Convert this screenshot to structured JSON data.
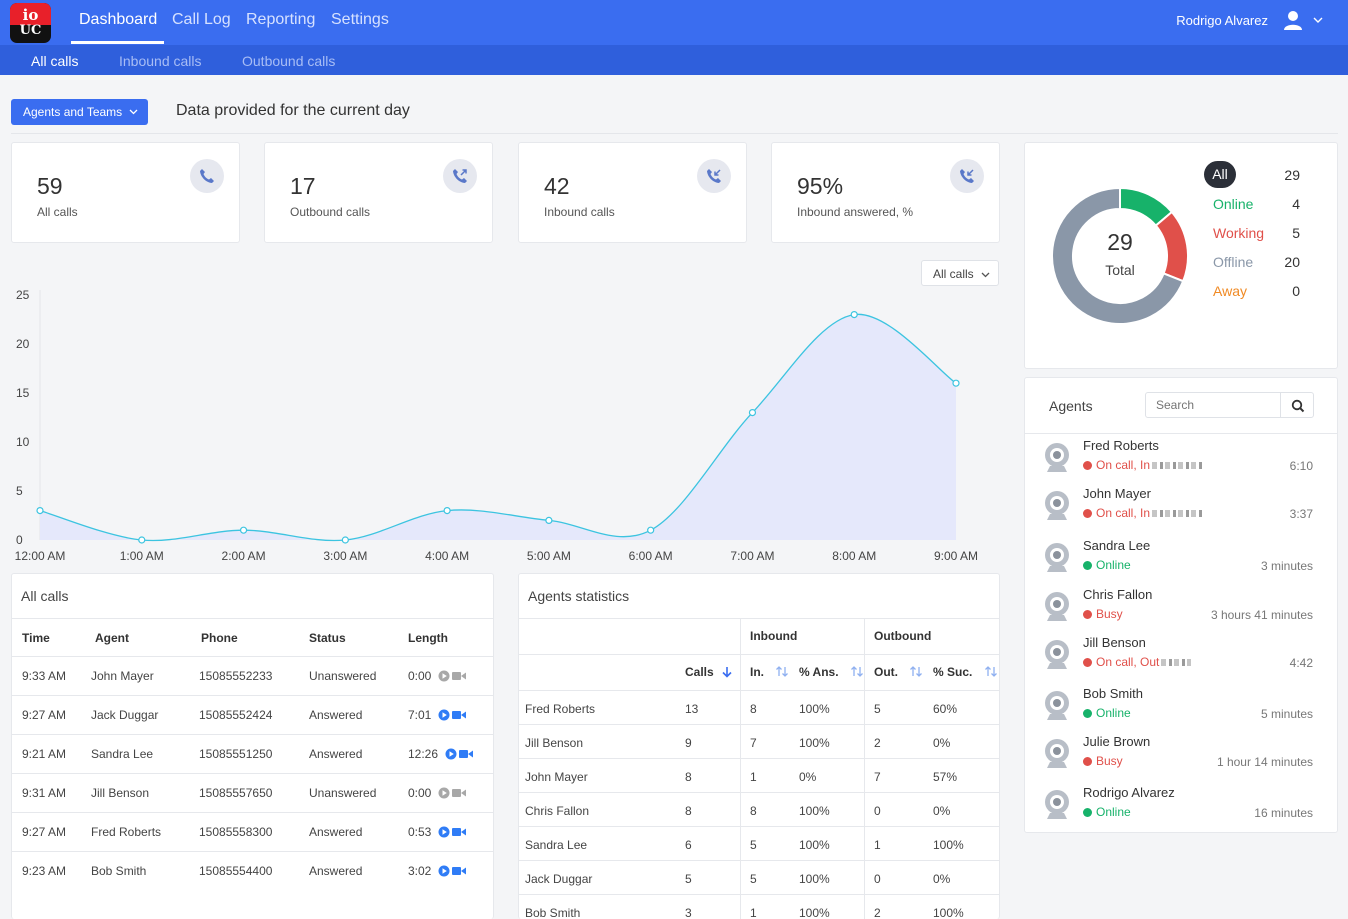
{
  "logo": {
    "top": "io",
    "bottom": "UC"
  },
  "nav": {
    "items": [
      "Dashboard",
      "Call Log",
      "Reporting",
      "Settings"
    ],
    "user": "Rodrigo Alvarez"
  },
  "subnav": {
    "items": [
      "All calls",
      "Inbound calls",
      "Outbound calls"
    ]
  },
  "header": {
    "agents_button": "Agents and Teams",
    "title": "Data provided for the current day"
  },
  "stats": [
    {
      "value": "59",
      "label": "All calls",
      "icon": "phone-icon"
    },
    {
      "value": "17",
      "label": "Outbound calls",
      "icon": "outbound-call-icon"
    },
    {
      "value": "42",
      "label": "Inbound calls",
      "icon": "inbound-call-icon"
    },
    {
      "value": "95%",
      "label": "Inbound answered, %",
      "icon": "inbound-call-icon"
    }
  ],
  "agent_status": {
    "total": "29",
    "total_label": "Total",
    "legend": [
      {
        "label": "All",
        "count": "29",
        "color": "#2b2f38"
      },
      {
        "label": "Online",
        "count": "4",
        "color": "#17b26a"
      },
      {
        "label": "Working",
        "count": "5",
        "color": "#e0504a"
      },
      {
        "label": "Offline",
        "count": "20",
        "color": "#8a97a8"
      },
      {
        "label": "Away",
        "count": "0",
        "color": "#f08a24"
      }
    ]
  },
  "chart_filter": "All calls",
  "chart_data": {
    "type": "area",
    "x": [
      "12:00 AM",
      "1:00 AM",
      "2:00 AM",
      "3:00 AM",
      "4:00 AM",
      "5:00 AM",
      "6:00 AM",
      "7:00 AM",
      "8:00 AM",
      "9:00 AM"
    ],
    "values": [
      3,
      0,
      1,
      0,
      3,
      2,
      1,
      13,
      23,
      16
    ],
    "ylim": [
      0,
      25
    ],
    "yticks": [
      "0",
      "5",
      "10",
      "15",
      "20",
      "25"
    ],
    "color": "#3cc4e0",
    "fill": "#e5e8fb"
  },
  "calls_table": {
    "title": "All calls",
    "headers": [
      "Time",
      "Agent",
      "Phone",
      "Status",
      "Length"
    ],
    "rows": [
      {
        "time": "9:33 AM",
        "agent": "John Mayer",
        "phone": "15085552233",
        "status": "Unanswered",
        "length": "0:00"
      },
      {
        "time": "9:27 AM",
        "agent": "Jack Duggar",
        "phone": "15085552424",
        "status": "Answered",
        "length": "7:01"
      },
      {
        "time": "9:21 AM",
        "agent": "Sandra Lee",
        "phone": "15085551250",
        "status": "Answered",
        "length": "12:26"
      },
      {
        "time": "9:31 AM",
        "agent": "Jill Benson",
        "phone": "15085557650",
        "status": "Unanswered",
        "length": "0:00"
      },
      {
        "time": "9:27 AM",
        "agent": "Fred Roberts",
        "phone": "15085558300",
        "status": "Answered",
        "length": "0:53"
      },
      {
        "time": "9:23 AM",
        "agent": "Bob Smith",
        "phone": "15085554400",
        "status": "Answered",
        "length": "3:02"
      }
    ]
  },
  "agents_stats": {
    "title": "Agents statistics",
    "group_inbound": "Inbound",
    "group_outbound": "Outbound",
    "headers": [
      "Calls",
      "In.",
      "% Ans.",
      "Out.",
      "% Suc."
    ],
    "rows": [
      {
        "name": "Fred Roberts",
        "calls": "13",
        "in": "8",
        "ans": "100%",
        "out": "5",
        "suc": "60%"
      },
      {
        "name": "Jill Benson",
        "calls": "9",
        "in": "7",
        "ans": "100%",
        "out": "2",
        "suc": "0%"
      },
      {
        "name": "John Mayer",
        "calls": "8",
        "in": "1",
        "ans": "0%",
        "out": "7",
        "suc": "57%"
      },
      {
        "name": "Chris Fallon",
        "calls": "8",
        "in": "8",
        "ans": "100%",
        "out": "0",
        "suc": "0%"
      },
      {
        "name": "Sandra Lee",
        "calls": "6",
        "in": "5",
        "ans": "100%",
        "out": "1",
        "suc": "100%"
      },
      {
        "name": "Jack Duggar",
        "calls": "5",
        "in": "5",
        "ans": "100%",
        "out": "0",
        "suc": "0%"
      },
      {
        "name": "Bob Smith",
        "calls": "3",
        "in": "1",
        "ans": "100%",
        "out": "2",
        "suc": "100%"
      }
    ]
  },
  "agents_list": {
    "title": "Agents",
    "search_placeholder": "Search",
    "agents": [
      {
        "name": "Fred Roberts",
        "status": "On call, In",
        "color": "#e0504a",
        "time": "6:10",
        "redacted": true
      },
      {
        "name": "John Mayer",
        "status": "On call, In",
        "color": "#e0504a",
        "time": "3:37",
        "redacted": true
      },
      {
        "name": "Sandra Lee",
        "status": "Online",
        "color": "#17b26a",
        "time": "3 minutes",
        "redacted": false
      },
      {
        "name": "Chris Fallon",
        "status": "Busy",
        "color": "#e0504a",
        "time": "3 hours 41 minutes",
        "redacted": false
      },
      {
        "name": "Jill Benson",
        "status": "On call, Out",
        "color": "#e0504a",
        "time": "4:42",
        "redacted": true
      },
      {
        "name": "Bob Smith",
        "status": "Online",
        "color": "#17b26a",
        "time": "5 minutes",
        "redacted": false
      },
      {
        "name": "Julie Brown",
        "status": "Busy",
        "color": "#e0504a",
        "time": "1 hour 14 minutes",
        "redacted": false
      },
      {
        "name": "Rodrigo Alvarez",
        "status": "Online",
        "color": "#17b26a",
        "time": "16 minutes",
        "redacted": false
      }
    ]
  }
}
